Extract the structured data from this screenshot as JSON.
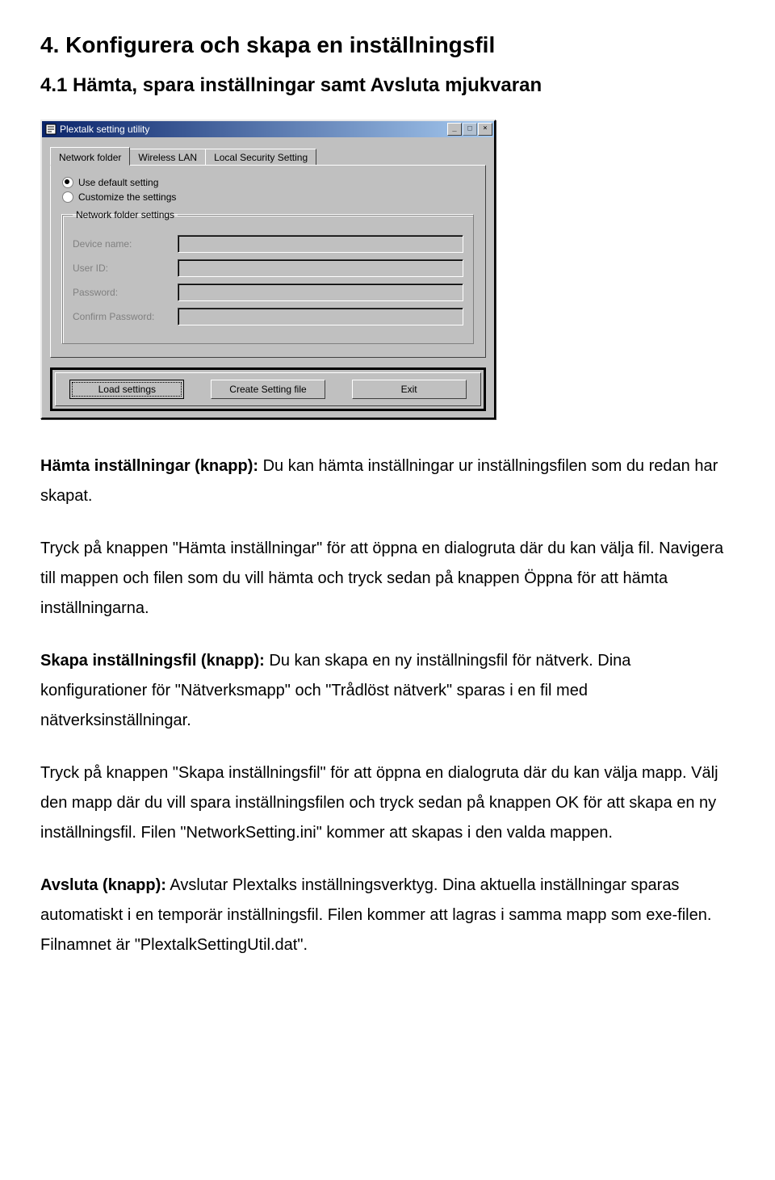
{
  "section": {
    "title": "4. Konfigurera och skapa en inställningsfil",
    "subtitle": "4.1 Hämta, spara inställningar samt Avsluta mjukvaran"
  },
  "window": {
    "title": "Plextalk setting utility",
    "buttons": {
      "min": "_",
      "max": "□",
      "close": "×"
    },
    "tabs": {
      "network_folder": "Network folder",
      "wireless_lan": "Wireless LAN",
      "local_security": "Local Security Setting"
    },
    "radios": {
      "use_default": "Use default setting",
      "customize": "Customize the settings"
    },
    "groupbox": {
      "legend": "Network folder settings",
      "device_name": "Device name:",
      "user_id": "User ID:",
      "password": "Password:",
      "confirm_password": "Confirm Password:"
    },
    "action_buttons": {
      "load": "Load settings",
      "create": "Create Setting file",
      "exit": "Exit"
    }
  },
  "paragraphs": {
    "p1_bold": "Hämta inställningar (knapp):",
    "p1_rest": " Du kan hämta inställningar ur inställningsfilen som du redan har skapat.",
    "p2": "Tryck på knappen \"Hämta inställningar\" för att öppna en dialogruta där du kan välja fil. Navigera till mappen och filen som du vill hämta och tryck sedan på knappen Öppna för att hämta inställningarna.",
    "p3_bold": "Skapa inställningsfil (knapp):",
    "p3_rest": " Du kan skapa en ny inställningsfil för nätverk. Dina konfigurationer för \"Nätverksmapp\" och \"Trådlöst nätverk\" sparas i en fil med nätverksinställningar.",
    "p4": "Tryck på knappen \"Skapa inställningsfil\" för att öppna en dialogruta där du kan välja mapp. Välj den mapp där du vill spara inställningsfilen och tryck sedan på knappen OK för att skapa en ny inställningsfil. Filen \"NetworkSetting.ini\" kommer att skapas i den valda mappen.",
    "p5_bold": "Avsluta (knapp):",
    "p5_rest": " Avslutar Plextalks inställningsverktyg. Dina aktuella inställningar sparas automatiskt i en temporär inställningsfil. Filen kommer att lagras i samma mapp som exe-filen. Filnamnet är \"PlextalkSettingUtil.dat\"."
  }
}
